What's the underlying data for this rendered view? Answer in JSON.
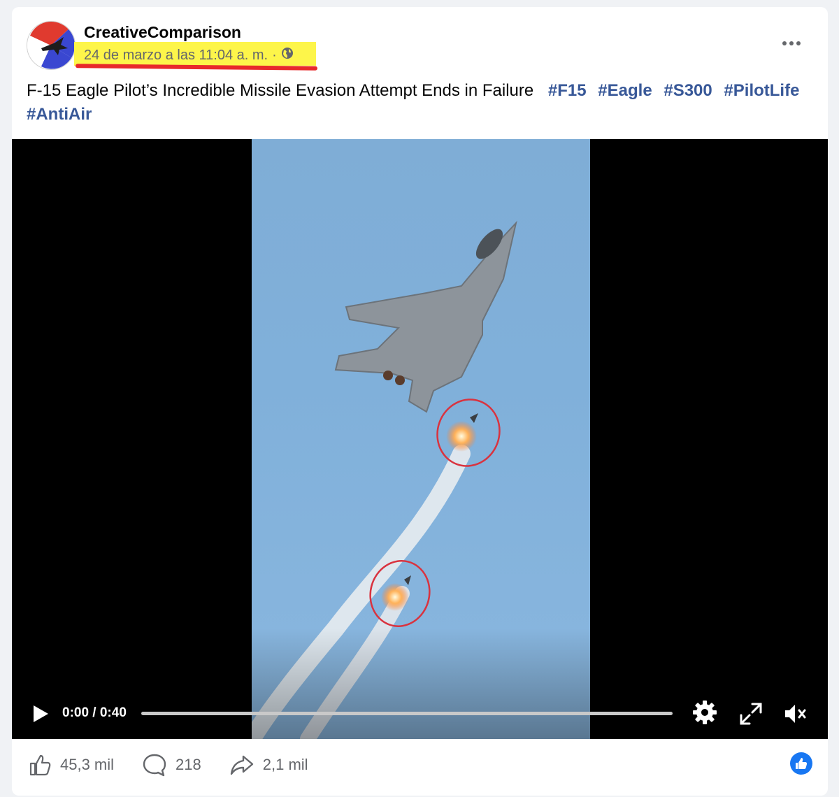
{
  "post": {
    "author": "CreativeComparison",
    "timestamp": "24 de marzo a las 11:04 a. m.",
    "separator": "·",
    "privacy_icon": "globe-icon",
    "caption": "F-15 Eagle Pilot’s Incredible Missile Evasion Attempt Ends in Failure",
    "hashtags": [
      "#F15",
      "#Eagle",
      "#S300",
      "#PilotLife",
      "#AntiAir"
    ]
  },
  "video": {
    "time_display": "0:00 / 0:40",
    "progress": 0,
    "controls": [
      "play-icon",
      "settings-icon",
      "fullscreen-icon",
      "mute-icon"
    ]
  },
  "actions": {
    "likes": "45,3 mil",
    "comments": "218",
    "shares": "2,1 mil"
  },
  "colors": {
    "highlight": "#fdf54a",
    "underline": "#e8292b",
    "hashtag": "#385898",
    "like_blue": "#1877f2",
    "sky": "#80b0da",
    "annotation_circle": "#d9333f"
  }
}
